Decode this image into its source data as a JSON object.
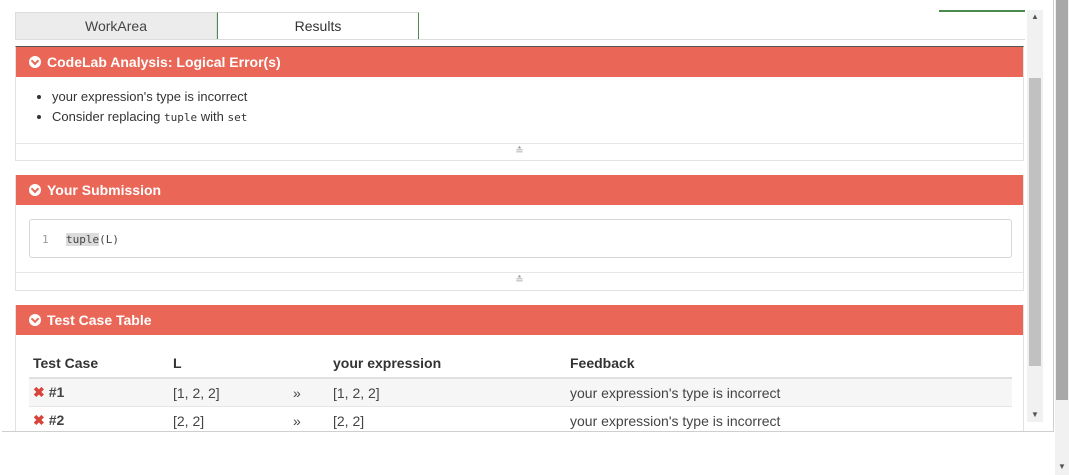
{
  "tabs": [
    {
      "label": "WorkArea",
      "active": false
    },
    {
      "label": "Results",
      "active": true
    }
  ],
  "analysis": {
    "title": "CodeLab Analysis: Logical Error(s)",
    "items": [
      {
        "text": "your expression's type is incorrect"
      },
      {
        "prefix": "Consider replacing ",
        "code1": "tuple",
        "middle": " with ",
        "code2": "set"
      }
    ]
  },
  "submission": {
    "title": "Your Submission",
    "line_number": "1",
    "code_highlight": "tuple",
    "code_rest": "(L)"
  },
  "test_cases": {
    "title": "Test Case Table",
    "columns": [
      "Test Case",
      "L",
      "",
      "your expression",
      "Feedback"
    ],
    "rows": [
      {
        "status": "✖",
        "id": "#1",
        "L": "[1, 2, 2]",
        "arrow": "»",
        "expr": "[1, 2, 2]",
        "feedback": "your expression's type is incorrect"
      },
      {
        "status": "✖",
        "id": "#2",
        "L": "[2, 2]",
        "arrow": "»",
        "expr": "[2, 2]",
        "feedback": "your expression's type is incorrect"
      }
    ]
  },
  "icons": {
    "panel_toggle": "chevron-down-circle-icon",
    "expand": "double-chevron-down-icon",
    "fail": "x-mark-icon"
  },
  "colors": {
    "header_bg": "#ea6656",
    "active_tab_border": "#4a8a4a",
    "fail": "#d9443a"
  }
}
